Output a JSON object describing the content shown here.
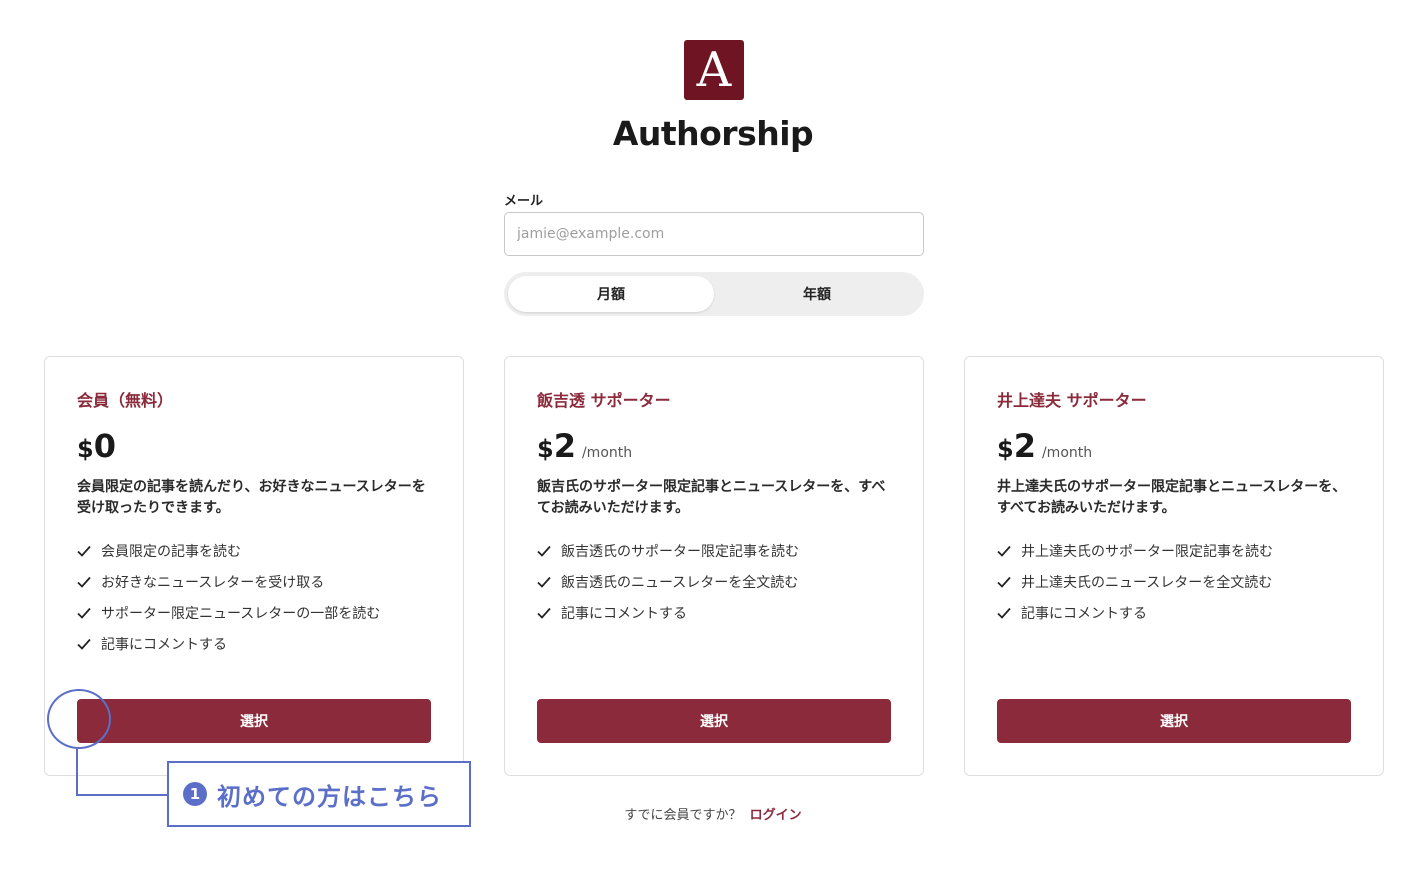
{
  "brand": {
    "logo_letter": "A",
    "name": "Authorship"
  },
  "form": {
    "email_label": "メール",
    "email_placeholder": "jamie@example.com"
  },
  "billing_toggle": {
    "monthly": "月額",
    "yearly": "年額",
    "selected": "月額"
  },
  "plans": [
    {
      "title": "会員（無料）",
      "currency": "$",
      "amount": "0",
      "period": "",
      "description": "会員限定の記事を読んだり、お好きなニュースレターを受け取ったりできます。",
      "features": [
        "会員限定の記事を読む",
        "お好きなニュースレターを受け取る",
        "サポーター限定ニュースレターの一部を読む",
        "記事にコメントする"
      ],
      "button": "選択"
    },
    {
      "title": "飯吉透 サポーター",
      "currency": "$",
      "amount": "2",
      "period": "/month",
      "description": "飯吉氏のサポーター限定記事とニュースレターを、すべてお読みいただけます。",
      "features": [
        "飯吉透氏のサポーター限定記事を読む",
        "飯吉透氏のニュースレターを全文読む",
        "記事にコメントする"
      ],
      "button": "選択"
    },
    {
      "title": "井上達夫 サポーター",
      "currency": "$",
      "amount": "2",
      "period": "/month",
      "description": "井上達夫氏のサポーター限定記事とニュースレターを、すべてお読みいただけます。",
      "features": [
        "井上達夫氏のサポーター限定記事を読む",
        "井上達夫氏のニュースレターを全文読む",
        "記事にコメントする"
      ],
      "button": "選択"
    }
  ],
  "login": {
    "prompt": "すでに会員ですか？",
    "link": "ログイン"
  },
  "annotation": {
    "number": "1",
    "text": "初めての方はこちら"
  },
  "colors": {
    "accent": "#8b2a3a",
    "logo_bg": "#6e1423",
    "annotation": "#5b6fc9"
  }
}
